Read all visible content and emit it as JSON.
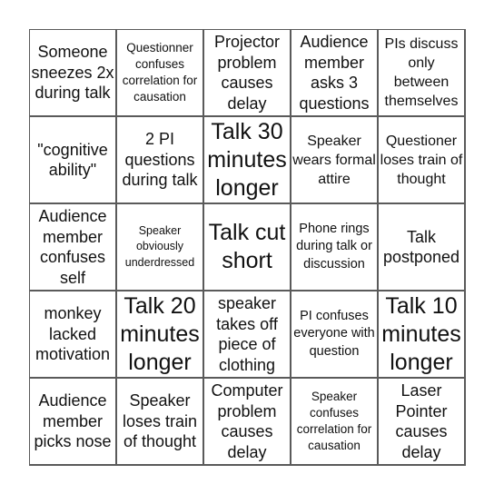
{
  "board": {
    "rows": [
      [
        {
          "text": "Someone sneezes 2x during talk",
          "size": "l"
        },
        {
          "text": "Questionner confuses correlation for causation",
          "size": "xs"
        },
        {
          "text": "Projector problem causes delay",
          "size": "l"
        },
        {
          "text": "Audience member asks 3 questions",
          "size": "l"
        },
        {
          "text": "PIs discuss only between themselves",
          "size": "m"
        }
      ],
      [
        {
          "text": "\"cognitive ability\"",
          "size": "l"
        },
        {
          "text": "2 PI questions during talk",
          "size": "l"
        },
        {
          "text": "Talk 30 minutes longer",
          "size": "xl"
        },
        {
          "text": "Speaker wears formal attire",
          "size": "m"
        },
        {
          "text": "Questioner loses train of thought",
          "size": "m"
        }
      ],
      [
        {
          "text": "Audience member confuses self",
          "size": "l"
        },
        {
          "text": "Speaker obviously underdressed",
          "size": "xxs"
        },
        {
          "text": "Talk cut short",
          "size": "xl"
        },
        {
          "text": "Phone rings during talk or discussion",
          "size": "s"
        },
        {
          "text": "Talk postponed",
          "size": "l"
        }
      ],
      [
        {
          "text": "monkey lacked motivation",
          "size": "l"
        },
        {
          "text": "Talk 20 minutes longer",
          "size": "xl"
        },
        {
          "text": "speaker takes off piece of clothing",
          "size": "l"
        },
        {
          "text": "PI confuses everyone with question",
          "size": "s"
        },
        {
          "text": "Talk 10 minutes longer",
          "size": "xl"
        }
      ],
      [
        {
          "text": "Audience member picks nose",
          "size": "l"
        },
        {
          "text": "Speaker loses train of thought",
          "size": "l"
        },
        {
          "text": "Computer problem causes delay",
          "size": "l"
        },
        {
          "text": "Speaker confuses correlation for causation",
          "size": "xs"
        },
        {
          "text": "Laser Pointer causes delay",
          "size": "l"
        }
      ]
    ]
  }
}
